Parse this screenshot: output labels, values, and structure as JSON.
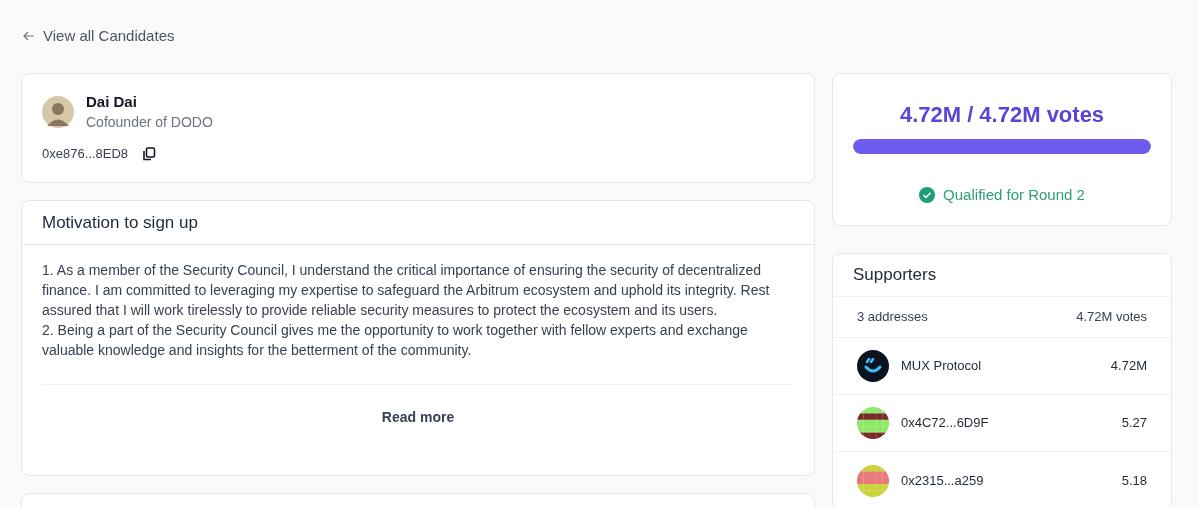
{
  "back_link": {
    "label": "View all Candidates"
  },
  "candidate": {
    "name": "Dai Dai",
    "role": "Cofounder of DODO",
    "address": "0xe876...8ED8"
  },
  "motivation": {
    "title": "Motivation to sign up",
    "paragraphs": [
      "1. As a member of the Security Council, I understand the critical importance of ensuring the security of decentralized finance. I am committed to leveraging my expertise to safeguard the Arbitrum ecosystem and uphold its integrity. Rest assured that I will work tirelessly to provide reliable security measures to protect the ecosystem and its users.",
      "2. Being a part of the Security Council gives me the opportunity to work together with fellow experts and exchange valuable knowledge and insights for the betterment of the community."
    ],
    "read_more": "Read more"
  },
  "votes": {
    "total": "4.72M / 4.72M votes",
    "level": 1,
    "status": "Qualified for Round 2",
    "qualified": true
  },
  "supporters": {
    "title": "Supporters",
    "count": "3 addresses",
    "total": "4.72M votes",
    "rows": [
      {
        "name": "MUX Protocol",
        "votes": "4.72M",
        "kind": "logo"
      },
      {
        "name": "0x4C72...6D9F",
        "votes": "5.27",
        "kind": "identicon"
      },
      {
        "name": "0x2315...a259",
        "votes": "5.18",
        "kind": "identicon"
      }
    ]
  }
}
